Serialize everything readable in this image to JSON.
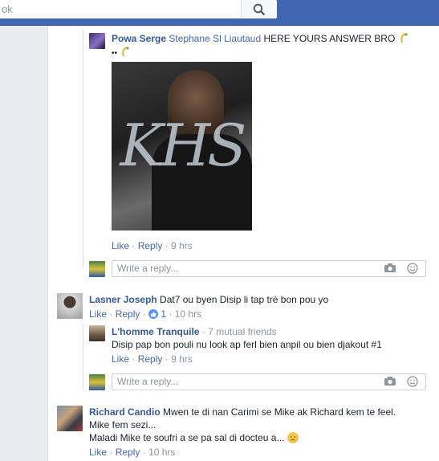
{
  "search": {
    "placeholder_fragment": "ok"
  },
  "comment1": {
    "author": "Powa Serge",
    "mention": "Stephane Sl Liautaud",
    "text": " HERE YOURS ANSWER BRO",
    "line2": "••",
    "image_text": "KHS",
    "like": "Like",
    "reply": "Reply",
    "time": "9 hrs"
  },
  "reply_box1": {
    "placeholder": "Write a reply..."
  },
  "comment2": {
    "author": "Lasner Joseph",
    "text": "Dat7 ou byen Disip li tap trè bon pou yo",
    "like": "Like",
    "reply": "Reply",
    "like_count": "1",
    "time": "10 hrs"
  },
  "reply2": {
    "author": "L'homme Tranquile",
    "mutual": "7 mutual friends",
    "text": "Disip pap bon pouli nu look ap ferl bien anpil ou bien djakout #1",
    "like": "Like",
    "reply": "Reply",
    "time": "9 hrs"
  },
  "reply_box2": {
    "placeholder": "Write a reply..."
  },
  "comment3": {
    "author": "Richard Candio",
    "text1": "Mwen te di nan Carimi se Mike ak Richard kem te feel.",
    "text2": "Mike fem sezi...",
    "text3": "Maladi Mike te soufri a se pa sal di docteu a...",
    "like": "Like",
    "reply": "Reply",
    "time": "10 hrs"
  },
  "separator": "·",
  "colors": {
    "header": "#4267b2",
    "link": "#365899",
    "meta": "#90949c"
  }
}
